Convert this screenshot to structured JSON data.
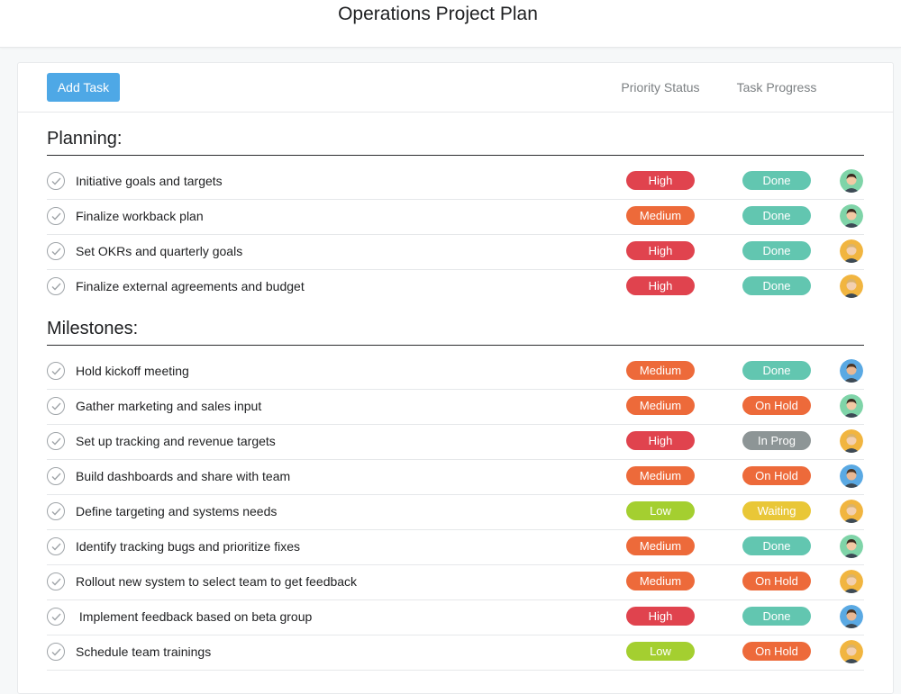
{
  "header": {
    "title": "Operations Project Plan"
  },
  "toolbar": {
    "add_task_label": "Add Task",
    "priority_header": "Priority Status",
    "progress_header": "Task Progress"
  },
  "colors": {
    "high": "#e0434e",
    "medium": "#ed6a3a",
    "low": "#a4cf30",
    "done": "#62c6b0",
    "on_hold": "#ed6a3a",
    "in_prog": "#8d9596",
    "waiting": "#e9c737",
    "accent": "#4ea8e6"
  },
  "sections": [
    {
      "title": "Planning:",
      "tasks": [
        {
          "name": "Initiative goals and targets",
          "priority": "High",
          "progress": "Done",
          "avatar": "green-avatar"
        },
        {
          "name": "Finalize workback plan",
          "priority": "Medium",
          "progress": "Done",
          "avatar": "green-avatar"
        },
        {
          "name": "Set OKRs and quarterly goals",
          "priority": "High",
          "progress": "Done",
          "avatar": "yellow-avatar"
        },
        {
          "name": "Finalize external agreements and budget",
          "priority": "High",
          "progress": "Done",
          "avatar": "yellow-avatar"
        }
      ]
    },
    {
      "title": "Milestones:",
      "tasks": [
        {
          "name": "Hold kickoff meeting",
          "priority": "Medium",
          "progress": "Done",
          "avatar": "blue-avatar"
        },
        {
          "name": "Gather marketing and sales input",
          "priority": "Medium",
          "progress": "On Hold",
          "avatar": "green-avatar"
        },
        {
          "name": "Set up tracking and revenue targets",
          "priority": "High",
          "progress": "In Prog",
          "avatar": "yellow-avatar"
        },
        {
          "name": "Build dashboards and share with team",
          "priority": "Medium",
          "progress": "On Hold",
          "avatar": "blue-avatar"
        },
        {
          "name": "Define targeting and systems needs",
          "priority": "Low",
          "progress": "Waiting",
          "avatar": "yellow-avatar"
        },
        {
          "name": "Identify tracking bugs and prioritize fixes",
          "priority": "Medium",
          "progress": "Done",
          "avatar": "green-avatar"
        },
        {
          "name": "Rollout new system to select team to get feedback",
          "priority": "Medium",
          "progress": "On Hold",
          "avatar": "yellow-avatar"
        },
        {
          "name": " Implement feedback based on beta group",
          "priority": "High",
          "progress": "Done",
          "avatar": "blue-avatar"
        },
        {
          "name": "Schedule team trainings",
          "priority": "Low",
          "progress": "On Hold",
          "avatar": "yellow-avatar"
        }
      ]
    }
  ]
}
